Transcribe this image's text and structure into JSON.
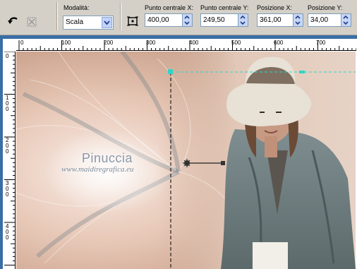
{
  "toolbar": {
    "mode": {
      "label": "Modalità:",
      "value": "Scala"
    },
    "center_x": {
      "label": "Punto centrale X:",
      "value": "400,00"
    },
    "center_y": {
      "label": "Punto centrale Y:",
      "value": "249,50"
    },
    "pos_x": {
      "label": "Posizione X:",
      "value": "361,00"
    },
    "pos_y": {
      "label": "Posizione Y:",
      "value": "34,00"
    }
  },
  "ruler": {
    "top_labels": [
      "0",
      "100",
      "200",
      "300",
      "400",
      "500",
      "600",
      "700"
    ],
    "left_labels": [
      "0",
      "100",
      "200",
      "300",
      "400"
    ]
  },
  "watermark": {
    "title": "Pinuccia",
    "url": "www.maidiregrafica.eu"
  },
  "colors": {
    "selection": "#2fd6c6",
    "accent_blue": "#3a6ea5",
    "toolbar_bg": "#d4d0c8"
  },
  "icons": [
    "undo-icon",
    "reset-icon",
    "center-pick-icon",
    "move-handle-icon"
  ]
}
